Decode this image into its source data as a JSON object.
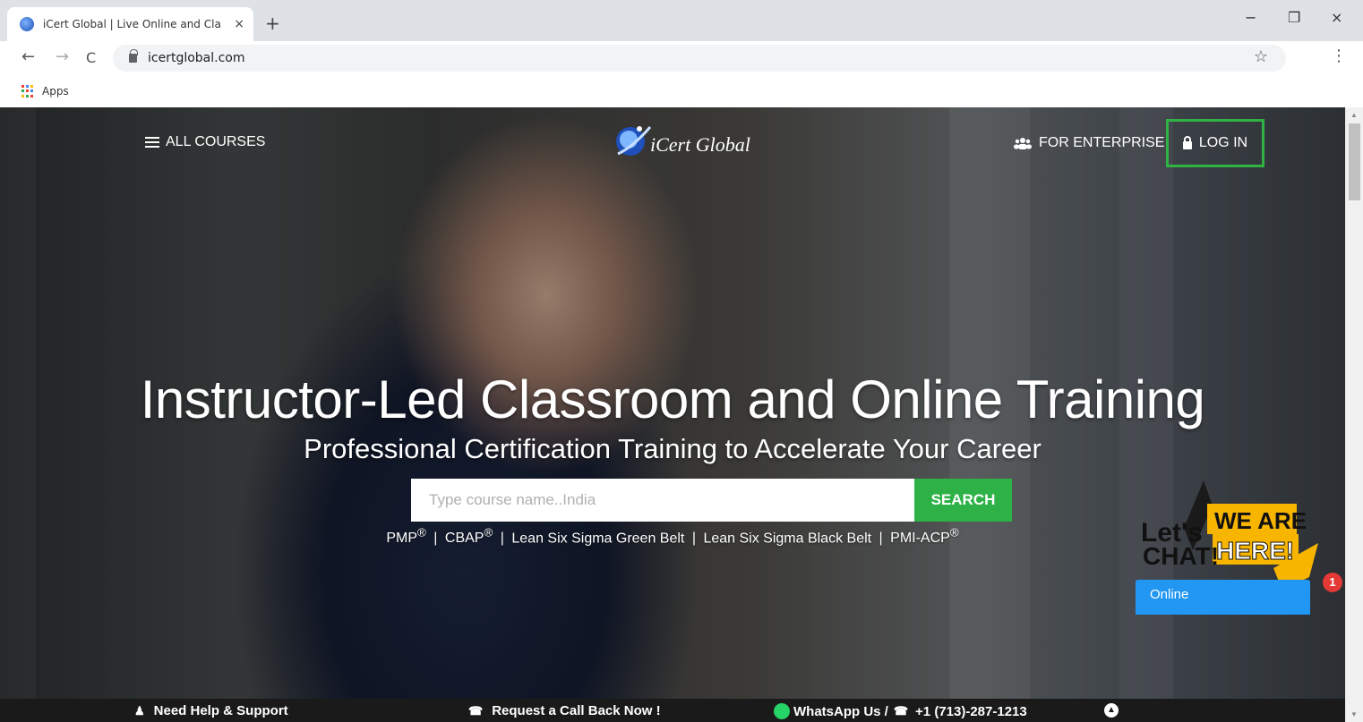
{
  "browser": {
    "tab_title": "iCert Global | Live Online and Cla",
    "tab_close": "×",
    "new_tab": "+",
    "url": "icertglobal.com",
    "bookmark": "Apps",
    "window_controls": {
      "minimize": "−",
      "restore": "❐",
      "close": "×"
    },
    "nav": {
      "back": "←",
      "forward": "→",
      "reload": "C"
    },
    "star": "☆",
    "menu": "⋮"
  },
  "header": {
    "all_courses": "ALL COURSES",
    "logo_text": "iCert Global",
    "for_enterprise": "FOR ENTERPRISE",
    "log_in": "LOG IN"
  },
  "hero": {
    "headline": "Instructor-Led Classroom and Online Training",
    "subline": "Professional Certification Training to Accelerate Your Career",
    "search_placeholder": "Type course name..India",
    "search_button": "SEARCH",
    "popular": [
      {
        "label": "PMP",
        "mark": "®"
      },
      {
        "label": "CBAP",
        "mark": "®"
      },
      {
        "label": "Lean Six Sigma Green Belt",
        "mark": ""
      },
      {
        "label": "Lean Six Sigma Black Belt",
        "mark": ""
      },
      {
        "label": "PMI-ACP",
        "mark": "®"
      }
    ],
    "separator": "|"
  },
  "chat": {
    "lets": "Let's",
    "chat": "CHAT!",
    "we_are": "WE ARE",
    "here": "HERE!",
    "status": "Online",
    "notification_count": "1"
  },
  "bottom_bar": {
    "help": "Need Help & Support",
    "callback": "Request a Call Back Now !",
    "whatsapp": "WhatsApp Us /",
    "phone": "+1 (713)-287-1213"
  },
  "colors": {
    "accent_green": "#2eb247",
    "login_border": "#2fb344",
    "chat_blue": "#2196f3",
    "chat_yellow": "#f7b500",
    "bottom_bar": "#1a1a1a"
  }
}
